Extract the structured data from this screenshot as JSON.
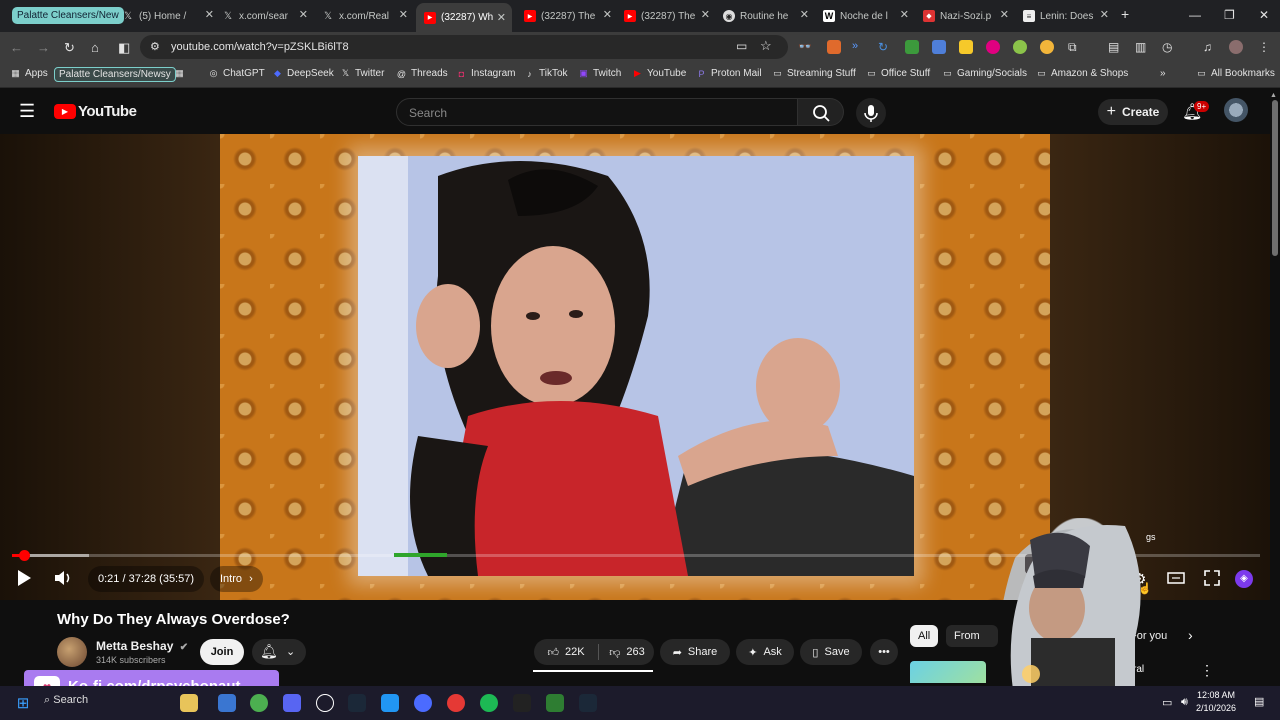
{
  "browser": {
    "tab_group": "Palatte Cleansers/New",
    "tabs": [
      {
        "title": "(5) Home /",
        "icon": "x-logo-icon"
      },
      {
        "title": "x.com/sear",
        "icon": "x-logo-icon"
      },
      {
        "title": "x.com/Real",
        "icon": "x-logo-icon"
      },
      {
        "title": "(32287) Wh",
        "icon": "youtube-icon",
        "active": true
      },
      {
        "title": "(32287) The",
        "icon": "youtube-icon"
      },
      {
        "title": "(32287) The",
        "icon": "youtube-icon"
      },
      {
        "title": "Routine he",
        "icon": "globe-icon"
      },
      {
        "title": "Noche de l",
        "icon": "wikipedia-icon"
      },
      {
        "title": "Nazi-Sozi.p",
        "icon": "pdf-icon"
      },
      {
        "title": "Lenin: Does",
        "icon": "document-icon"
      }
    ],
    "url": "youtube.com/watch?v=pZSKLBi6lT8",
    "bookmarks": {
      "apps": "Apps",
      "group": "Palatte Cleansers/Newsy",
      "items": [
        {
          "label": "ChatGPT",
          "icon": "chatgpt-icon"
        },
        {
          "label": "DeepSeek",
          "icon": "deepseek-icon"
        },
        {
          "label": "Twitter",
          "icon": "x-logo-icon"
        },
        {
          "label": "Threads",
          "icon": "threads-icon"
        },
        {
          "label": "Instagram",
          "icon": "instagram-icon"
        },
        {
          "label": "TikTok",
          "icon": "tiktok-icon"
        },
        {
          "label": "Twitch",
          "icon": "twitch-icon"
        },
        {
          "label": "YouTube",
          "icon": "youtube-icon"
        },
        {
          "label": "Proton Mail",
          "icon": "proton-icon"
        },
        {
          "label": "Streaming Stuff",
          "icon": "folder-icon"
        },
        {
          "label": "Office Stuff",
          "icon": "folder-icon"
        },
        {
          "label": "Gaming/Socials",
          "icon": "folder-icon"
        },
        {
          "label": "Amazon & Shops",
          "icon": "folder-icon"
        }
      ],
      "all_bookmarks": "All Bookmarks"
    }
  },
  "youtube": {
    "logo": "YouTube",
    "search_placeholder": "Search",
    "create_label": "Create",
    "notification_count": "9+",
    "player": {
      "time": "0:21 / 37:28 (35:57)",
      "chapter": "Intro",
      "progress_fraction": 0.0094,
      "buffer_fraction": 0.062,
      "settings_tooltip_partial": "gs"
    },
    "video": {
      "title": "Why Do They Always Overdose?",
      "channel": "Metta Beshay",
      "subscribers": "314K subscribers",
      "join": "Join",
      "likes": "22K",
      "dislikes": "263",
      "share": "Share",
      "ask": "Ask",
      "save": "Save"
    },
    "chips": [
      "All",
      "From M",
      "For you"
    ],
    "sidebar_partial": "ral"
  },
  "overlay": {
    "kofi": "Ko-fi.com/drpsychonaut"
  },
  "taskbar": {
    "search": "Search",
    "time": "12:08 AM",
    "date": "2/10/2026"
  },
  "colors": {
    "youtube_red": "#ff0000",
    "tab_group_teal": "#7ccfcb",
    "kofi_purple": "#a97bf0"
  }
}
